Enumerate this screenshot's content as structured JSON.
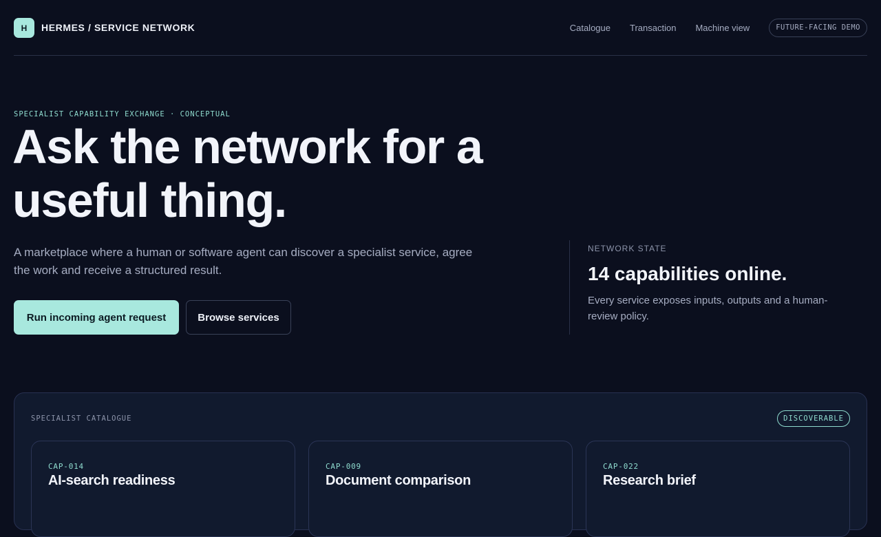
{
  "header": {
    "logo_letter": "H",
    "brand": "HERMES / SERVICE NETWORK",
    "nav": [
      "Catalogue",
      "Transaction",
      "Machine view"
    ],
    "badge": "FUTURE-FACING DEMO"
  },
  "hero": {
    "eyebrow": "SPECIALIST CAPABILITY EXCHANGE · CONCEPTUAL",
    "headline": "Ask the network for a useful thing.",
    "lede": "A marketplace where a human or software agent can discover a specialist service, agree the work and receive a structured result.",
    "primary_button": "Run incoming agent request",
    "secondary_button": "Browse services"
  },
  "network_state": {
    "label": "NETWORK STATE",
    "title": "14 capabilities online.",
    "description": "Every service exposes inputs, outputs and a human-review policy."
  },
  "catalogue": {
    "label": "SPECIALIST CATALOGUE",
    "badge": "DISCOVERABLE",
    "cards": [
      {
        "id": "CAP-014",
        "title": "AI-search readiness"
      },
      {
        "id": "CAP-009",
        "title": "Document comparison"
      },
      {
        "id": "CAP-022",
        "title": "Research brief"
      }
    ]
  },
  "colors": {
    "background": "#0b0f1e",
    "accent": "#a8e8de",
    "accent_text": "#8fdccf",
    "panel": "#111a2e"
  }
}
